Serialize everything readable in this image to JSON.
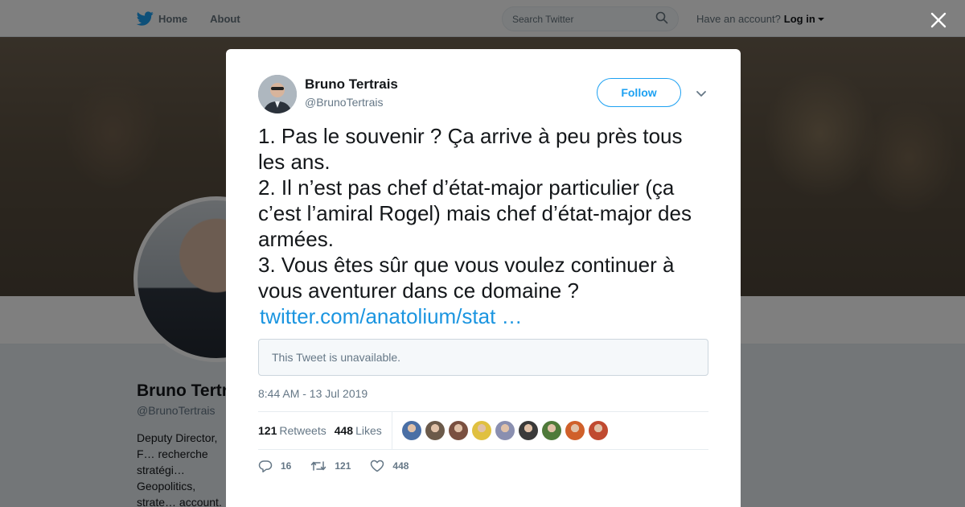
{
  "topbar": {
    "home_label": "Home",
    "about_label": "About",
    "search_placeholder": "Search Twitter",
    "account_prompt": "Have an account?",
    "login_label": "Log in"
  },
  "profile": {
    "name": "Bruno Tertrais",
    "handle": "@BrunoTertrais",
    "bio": "Deputy Director, F… recherche stratégi… Geopolitics, strate… account. e-mail: b…"
  },
  "tweet": {
    "author_name": "Bruno Tertrais",
    "author_handle": "@BrunoTertrais",
    "follow_label": "Follow",
    "lines": [
      "1. Pas le souvenir ? Ça arrive à peu près tous les ans.",
      "2. Il n’est pas chef d’état-major particulier (ça c’est l’amiral Rogel) mais chef d’état-major des armées.",
      "3. Vous êtes sûr que vous voulez continuer à vous aventurer dans ce domaine ?"
    ],
    "link_text": "twitter.com/anatolium/stat …",
    "quote_unavailable": "This Tweet is unavailable.",
    "timestamp": "8:44 AM - 13 Jul 2019",
    "retweets_count": "121",
    "retweets_label": "Retweets",
    "likes_count": "448",
    "likes_label": "Likes",
    "reply_count": "16",
    "retweet_action_count": "121",
    "like_action_count": "448"
  },
  "colors": {
    "accent": "#1da1f2",
    "link": "#1b95e0",
    "text_secondary": "#657786"
  },
  "likers": [
    {
      "name": "liker-avatar-1",
      "color": "#4a6fa5"
    },
    {
      "name": "liker-avatar-2",
      "color": "#6b5a4a"
    },
    {
      "name": "liker-avatar-3",
      "color": "#7a5040"
    },
    {
      "name": "liker-avatar-4",
      "color": "#e0c040"
    },
    {
      "name": "liker-avatar-5",
      "color": "#8a8fb0"
    },
    {
      "name": "liker-avatar-6",
      "color": "#3a3a3a"
    },
    {
      "name": "liker-avatar-7",
      "color": "#4f7a3a"
    },
    {
      "name": "liker-avatar-8",
      "color": "#d0602a"
    },
    {
      "name": "liker-avatar-9",
      "color": "#c04a30"
    }
  ]
}
